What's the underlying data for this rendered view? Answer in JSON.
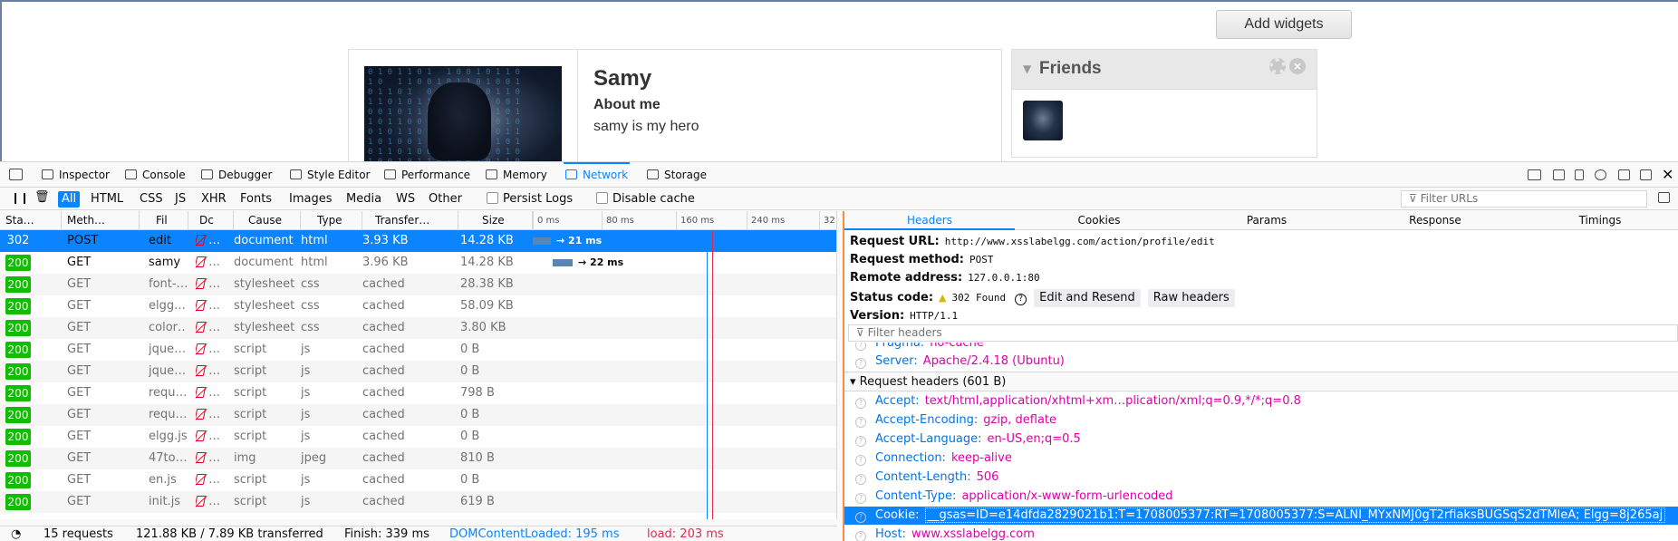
{
  "page": {
    "add_widgets": "Add widgets",
    "profile": {
      "name": "Samy",
      "about_label": "About me",
      "about_text": "samy is my hero"
    },
    "friends": {
      "title": "Friends"
    }
  },
  "devtools": {
    "tabs": [
      "Inspector",
      "Console",
      "Debugger",
      "Style Editor",
      "Performance",
      "Memory",
      "Network",
      "Storage"
    ],
    "active_tab": "Network",
    "filters": [
      "All",
      "HTML",
      "CSS",
      "JS",
      "XHR",
      "Fonts",
      "Images",
      "Media",
      "WS",
      "Other"
    ],
    "persist_logs": "Persist Logs",
    "disable_cache": "Disable cache",
    "filter_urls_placeholder": "Filter URLs",
    "columns": [
      "Sta…",
      "Meth…",
      "Fil",
      "Dc",
      "Cause",
      "Type",
      "Transfer…",
      "Size"
    ],
    "timeline_ticks": [
      "0 ms",
      "80 ms",
      "160 ms",
      "240 ms",
      "32"
    ],
    "requests": [
      {
        "status": "302",
        "method": "POST",
        "file": "edit",
        "cause": "document",
        "type": "html",
        "transferred": "3.93 KB",
        "size": "14.28 KB",
        "wf_label": "→ 21 ms",
        "selected": true
      },
      {
        "status": "200",
        "method": "GET",
        "file": "samy",
        "cause": "document",
        "type": "html",
        "transferred": "3.96 KB",
        "size": "14.28 KB",
        "wf_label": "→ 22 ms"
      },
      {
        "status": "200",
        "method": "GET",
        "file": "font-…",
        "cause": "stylesheet",
        "type": "css",
        "transferred": "cached",
        "size": "28.38 KB"
      },
      {
        "status": "200",
        "method": "GET",
        "file": "elgg.…",
        "cause": "stylesheet",
        "type": "css",
        "transferred": "cached",
        "size": "58.09 KB"
      },
      {
        "status": "200",
        "method": "GET",
        "file": "color…",
        "cause": "stylesheet",
        "type": "css",
        "transferred": "cached",
        "size": "3.80 KB"
      },
      {
        "status": "200",
        "method": "GET",
        "file": "jque…",
        "cause": "script",
        "type": "js",
        "transferred": "cached",
        "size": "0 B"
      },
      {
        "status": "200",
        "method": "GET",
        "file": "jque…",
        "cause": "script",
        "type": "js",
        "transferred": "cached",
        "size": "0 B"
      },
      {
        "status": "200",
        "method": "GET",
        "file": "requ…",
        "cause": "script",
        "type": "js",
        "transferred": "cached",
        "size": "798 B"
      },
      {
        "status": "200",
        "method": "GET",
        "file": "requ…",
        "cause": "script",
        "type": "js",
        "transferred": "cached",
        "size": "0 B"
      },
      {
        "status": "200",
        "method": "GET",
        "file": "elgg.js",
        "cause": "script",
        "type": "js",
        "transferred": "cached",
        "size": "0 B"
      },
      {
        "status": "200",
        "method": "GET",
        "file": "47to…",
        "cause": "img",
        "type": "jpeg",
        "transferred": "cached",
        "size": "810 B"
      },
      {
        "status": "200",
        "method": "GET",
        "file": "en.js",
        "cause": "script",
        "type": "js",
        "transferred": "cached",
        "size": "0 B"
      },
      {
        "status": "200",
        "method": "GET",
        "file": "init.js",
        "cause": "script",
        "type": "js",
        "transferred": "cached",
        "size": "619 B"
      }
    ],
    "statusbar": {
      "requests": "15 requests",
      "transferred": "121.88 KB / 7.89 KB transferred",
      "finish": "Finish: 339 ms",
      "domcontentloaded": "DOMContentLoaded: 195 ms",
      "load": "load: 203 ms"
    },
    "details": {
      "tabs": [
        "Headers",
        "Cookies",
        "Params",
        "Response",
        "Timings"
      ],
      "active_tab": "Headers",
      "request_url_label": "Request URL:",
      "request_url": "http://www.xsslabelgg.com/action/profile/edit",
      "request_method_label": "Request method:",
      "request_method": "POST",
      "remote_address_label": "Remote address:",
      "remote_address": "127.0.0.1:80",
      "status_code_label": "Status code:",
      "status_code": "302 Found",
      "edit_resend": "Edit and Resend",
      "raw_headers": "Raw headers",
      "version_label": "Version:",
      "version": "HTTP/1.1",
      "filter_headers_placeholder": "Filter headers",
      "partial_header": {
        "key": "Pragma:",
        "value": "no-cache"
      },
      "server_header": {
        "key": "Server:",
        "value": "Apache/2.4.18 (Ubuntu)"
      },
      "request_headers_title": "Request headers (601 B)",
      "request_headers": [
        {
          "key": "Accept:",
          "value": "text/html,application/xhtml+xm…plication/xml;q=0.9,*/*;q=0.8"
        },
        {
          "key": "Accept-Encoding:",
          "value": "gzip, deflate"
        },
        {
          "key": "Accept-Language:",
          "value": "en-US,en;q=0.5"
        },
        {
          "key": "Connection:",
          "value": "keep-alive"
        },
        {
          "key": "Content-Length:",
          "value": "506"
        },
        {
          "key": "Content-Type:",
          "value": "application/x-www-form-urlencoded"
        },
        {
          "key": "Cookie:",
          "value": "__gsas=ID=e14dfda2829021b1:T=1708005377:RT=1708005377:S=ALNI_MYxNMJ0gT2rfiaksBUGSqS2dTMleA; Elgg=8j265aj",
          "selected": true
        },
        {
          "key": "Host:",
          "value": "www.xsslabelgg.com"
        }
      ]
    }
  }
}
